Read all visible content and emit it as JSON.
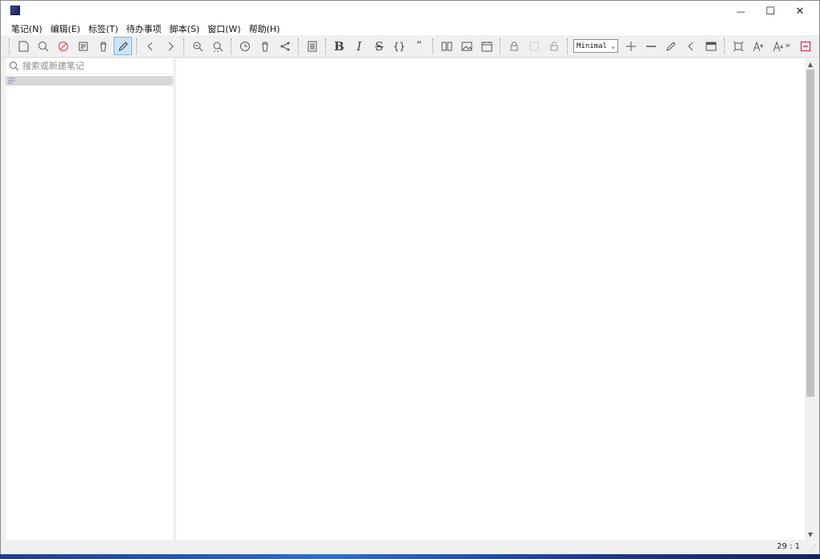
{
  "window": {
    "title": "",
    "controls": {
      "minimize": "—",
      "maximize": "☐",
      "close": "✕"
    }
  },
  "menu": [
    "笔记(N)",
    "编辑(E)",
    "标签(T)",
    "待办事项",
    "脚本(S)",
    "窗口(W)",
    "帮助(H)"
  ],
  "toolbar": {
    "bold": "B",
    "italic": "I",
    "strike": "S",
    "code": "{}",
    "quote": "“",
    "style_select": "Minimal",
    "more": "»"
  },
  "search": {
    "placeholder": "搜索或新建笔记"
  },
  "status": {
    "cursor_position": "29 : 1"
  },
  "colors": {
    "active_button": "#cce4f7",
    "accent_close": "#d23a52"
  }
}
